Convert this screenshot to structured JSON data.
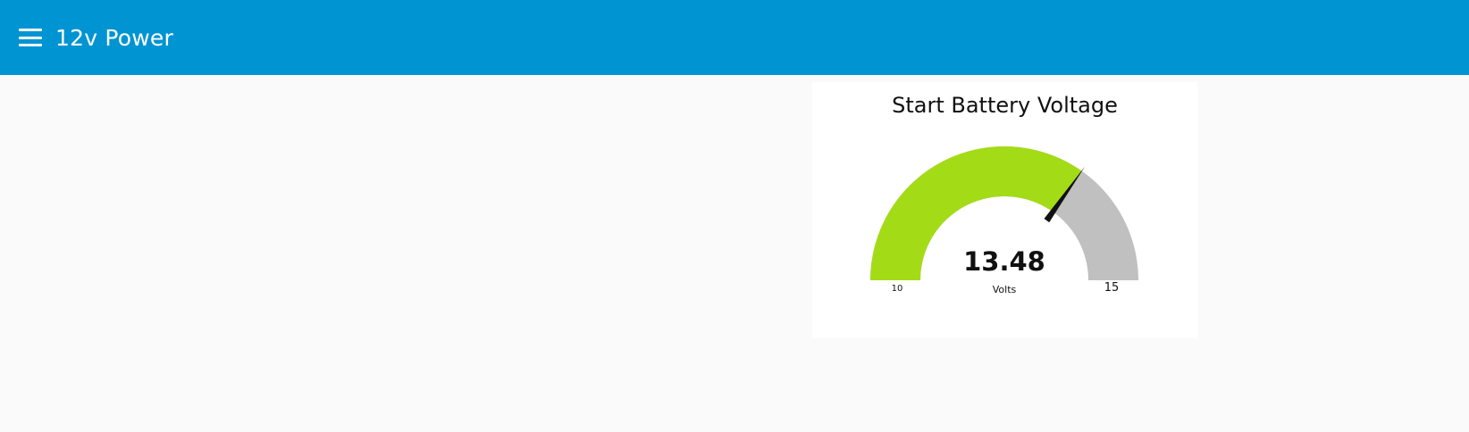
{
  "header": {
    "title": "12v Power"
  },
  "gauge": {
    "title": "Start Battery Voltage",
    "value": 13.48,
    "value_text": "13.48",
    "units": "Volts",
    "min": 10,
    "max": 15,
    "min_label": "10",
    "max_label": "15",
    "colors": {
      "fill": "#a3dc16",
      "track": "#c0c0c0",
      "needle": "#111111"
    }
  },
  "colors": {
    "toolbar": "#0094d2",
    "page_background": "#fafafa",
    "card_background": "#ffffff"
  }
}
